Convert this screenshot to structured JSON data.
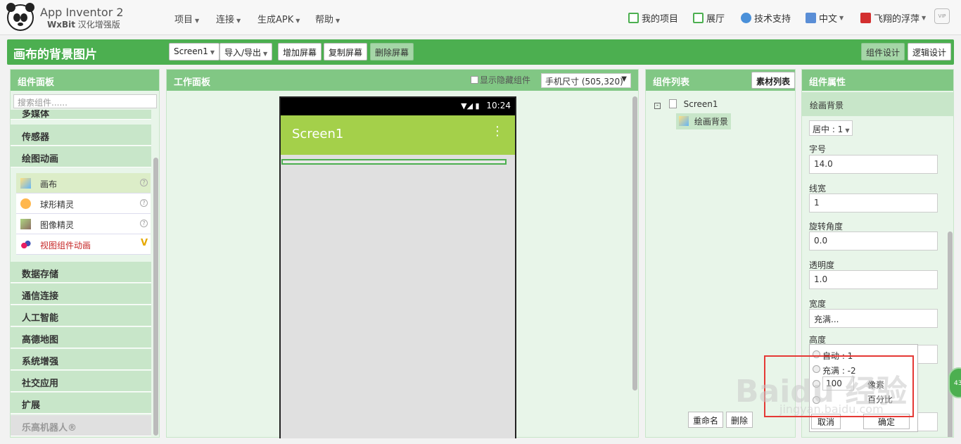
{
  "app": {
    "title": "App Inventor 2",
    "sub_bold": "WxBit",
    "sub_rest": " 汉化增强版"
  },
  "menu": [
    {
      "label": "项目"
    },
    {
      "label": "连接"
    },
    {
      "label": "生成APK"
    },
    {
      "label": "帮助"
    }
  ],
  "topright": {
    "my_projects": "我的项目",
    "gallery": "展厅",
    "support": "技术支持",
    "language": "中文",
    "user": "飞翔的浮萍",
    "vip": "VIP"
  },
  "toolbar": {
    "screen_title": "画布的背景图片",
    "screen_select": "Screen1",
    "import_export": "导入/导出",
    "add_screen": "增加屏幕",
    "copy_screen": "复制屏幕",
    "delete_screen": "删除屏幕",
    "designer": "组件设计",
    "blocks": "逻辑设计"
  },
  "palette": {
    "title": "组件面板",
    "search_placeholder": "搜索组件......",
    "categories_top": [
      "多媒体",
      "传感器",
      "绘图动画"
    ],
    "components": [
      {
        "label": "画布",
        "mark": "?"
      },
      {
        "label": "球形精灵",
        "mark": "?"
      },
      {
        "label": "图像精灵",
        "mark": "?"
      },
      {
        "label": "视图组件动画",
        "mark": "V"
      }
    ],
    "categories_bottom": [
      "数据存储",
      "通信连接",
      "人工智能",
      "高德地图",
      "系统增强",
      "社交应用",
      "扩展",
      "乐高机器人®"
    ]
  },
  "viewer": {
    "title": "工作面板",
    "show_hidden": "显示隐藏组件",
    "phone_size": "手机尺寸 (505,320)",
    "time": "10:24",
    "screen_name": "Screen1"
  },
  "tree": {
    "title": "组件列表",
    "assets_button": "素材列表",
    "root": "Screen1",
    "child": "绘画背景",
    "rename": "重命名",
    "delete": "删除"
  },
  "props": {
    "title": "组件属性",
    "component": "绘画背景",
    "align_value": "居中 : 1",
    "fields": [
      {
        "label": "字号",
        "value": "14.0"
      },
      {
        "label": "线宽",
        "value": "1"
      },
      {
        "label": "旋转角度",
        "value": "0.0"
      },
      {
        "label": "透明度",
        "value": "1.0"
      },
      {
        "label": "宽度",
        "value": "充满..."
      }
    ],
    "height_label": "高度",
    "popup": {
      "opt_auto": "自动 : 1",
      "opt_fill": "充满 : -2",
      "opt_px_value": "100",
      "opt_px_unit": "像素",
      "opt_percent": "百分比",
      "cancel": "取消",
      "ok": "确定"
    }
  },
  "watermark": {
    "brand": "Baidu 经验",
    "url": "jingyan.baidu.com"
  },
  "colors": {
    "green": "#4caf50",
    "green_light": "#81c784",
    "appbar": "#a4d04a",
    "highlight": "#e53935"
  }
}
